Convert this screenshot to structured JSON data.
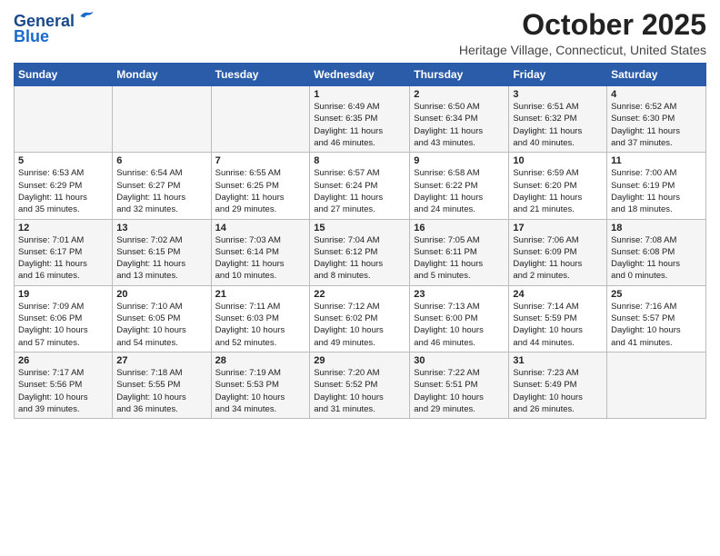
{
  "header": {
    "logo_line1": "General",
    "logo_line2": "Blue",
    "month": "October 2025",
    "location": "Heritage Village, Connecticut, United States"
  },
  "weekdays": [
    "Sunday",
    "Monday",
    "Tuesday",
    "Wednesday",
    "Thursday",
    "Friday",
    "Saturday"
  ],
  "weeks": [
    [
      {
        "day": "",
        "info": ""
      },
      {
        "day": "",
        "info": ""
      },
      {
        "day": "",
        "info": ""
      },
      {
        "day": "1",
        "info": "Sunrise: 6:49 AM\nSunset: 6:35 PM\nDaylight: 11 hours\nand 46 minutes."
      },
      {
        "day": "2",
        "info": "Sunrise: 6:50 AM\nSunset: 6:34 PM\nDaylight: 11 hours\nand 43 minutes."
      },
      {
        "day": "3",
        "info": "Sunrise: 6:51 AM\nSunset: 6:32 PM\nDaylight: 11 hours\nand 40 minutes."
      },
      {
        "day": "4",
        "info": "Sunrise: 6:52 AM\nSunset: 6:30 PM\nDaylight: 11 hours\nand 37 minutes."
      }
    ],
    [
      {
        "day": "5",
        "info": "Sunrise: 6:53 AM\nSunset: 6:29 PM\nDaylight: 11 hours\nand 35 minutes."
      },
      {
        "day": "6",
        "info": "Sunrise: 6:54 AM\nSunset: 6:27 PM\nDaylight: 11 hours\nand 32 minutes."
      },
      {
        "day": "7",
        "info": "Sunrise: 6:55 AM\nSunset: 6:25 PM\nDaylight: 11 hours\nand 29 minutes."
      },
      {
        "day": "8",
        "info": "Sunrise: 6:57 AM\nSunset: 6:24 PM\nDaylight: 11 hours\nand 27 minutes."
      },
      {
        "day": "9",
        "info": "Sunrise: 6:58 AM\nSunset: 6:22 PM\nDaylight: 11 hours\nand 24 minutes."
      },
      {
        "day": "10",
        "info": "Sunrise: 6:59 AM\nSunset: 6:20 PM\nDaylight: 11 hours\nand 21 minutes."
      },
      {
        "day": "11",
        "info": "Sunrise: 7:00 AM\nSunset: 6:19 PM\nDaylight: 11 hours\nand 18 minutes."
      }
    ],
    [
      {
        "day": "12",
        "info": "Sunrise: 7:01 AM\nSunset: 6:17 PM\nDaylight: 11 hours\nand 16 minutes."
      },
      {
        "day": "13",
        "info": "Sunrise: 7:02 AM\nSunset: 6:15 PM\nDaylight: 11 hours\nand 13 minutes."
      },
      {
        "day": "14",
        "info": "Sunrise: 7:03 AM\nSunset: 6:14 PM\nDaylight: 11 hours\nand 10 minutes."
      },
      {
        "day": "15",
        "info": "Sunrise: 7:04 AM\nSunset: 6:12 PM\nDaylight: 11 hours\nand 8 minutes."
      },
      {
        "day": "16",
        "info": "Sunrise: 7:05 AM\nSunset: 6:11 PM\nDaylight: 11 hours\nand 5 minutes."
      },
      {
        "day": "17",
        "info": "Sunrise: 7:06 AM\nSunset: 6:09 PM\nDaylight: 11 hours\nand 2 minutes."
      },
      {
        "day": "18",
        "info": "Sunrise: 7:08 AM\nSunset: 6:08 PM\nDaylight: 11 hours\nand 0 minutes."
      }
    ],
    [
      {
        "day": "19",
        "info": "Sunrise: 7:09 AM\nSunset: 6:06 PM\nDaylight: 10 hours\nand 57 minutes."
      },
      {
        "day": "20",
        "info": "Sunrise: 7:10 AM\nSunset: 6:05 PM\nDaylight: 10 hours\nand 54 minutes."
      },
      {
        "day": "21",
        "info": "Sunrise: 7:11 AM\nSunset: 6:03 PM\nDaylight: 10 hours\nand 52 minutes."
      },
      {
        "day": "22",
        "info": "Sunrise: 7:12 AM\nSunset: 6:02 PM\nDaylight: 10 hours\nand 49 minutes."
      },
      {
        "day": "23",
        "info": "Sunrise: 7:13 AM\nSunset: 6:00 PM\nDaylight: 10 hours\nand 46 minutes."
      },
      {
        "day": "24",
        "info": "Sunrise: 7:14 AM\nSunset: 5:59 PM\nDaylight: 10 hours\nand 44 minutes."
      },
      {
        "day": "25",
        "info": "Sunrise: 7:16 AM\nSunset: 5:57 PM\nDaylight: 10 hours\nand 41 minutes."
      }
    ],
    [
      {
        "day": "26",
        "info": "Sunrise: 7:17 AM\nSunset: 5:56 PM\nDaylight: 10 hours\nand 39 minutes."
      },
      {
        "day": "27",
        "info": "Sunrise: 7:18 AM\nSunset: 5:55 PM\nDaylight: 10 hours\nand 36 minutes."
      },
      {
        "day": "28",
        "info": "Sunrise: 7:19 AM\nSunset: 5:53 PM\nDaylight: 10 hours\nand 34 minutes."
      },
      {
        "day": "29",
        "info": "Sunrise: 7:20 AM\nSunset: 5:52 PM\nDaylight: 10 hours\nand 31 minutes."
      },
      {
        "day": "30",
        "info": "Sunrise: 7:22 AM\nSunset: 5:51 PM\nDaylight: 10 hours\nand 29 minutes."
      },
      {
        "day": "31",
        "info": "Sunrise: 7:23 AM\nSunset: 5:49 PM\nDaylight: 10 hours\nand 26 minutes."
      },
      {
        "day": "",
        "info": ""
      }
    ]
  ]
}
